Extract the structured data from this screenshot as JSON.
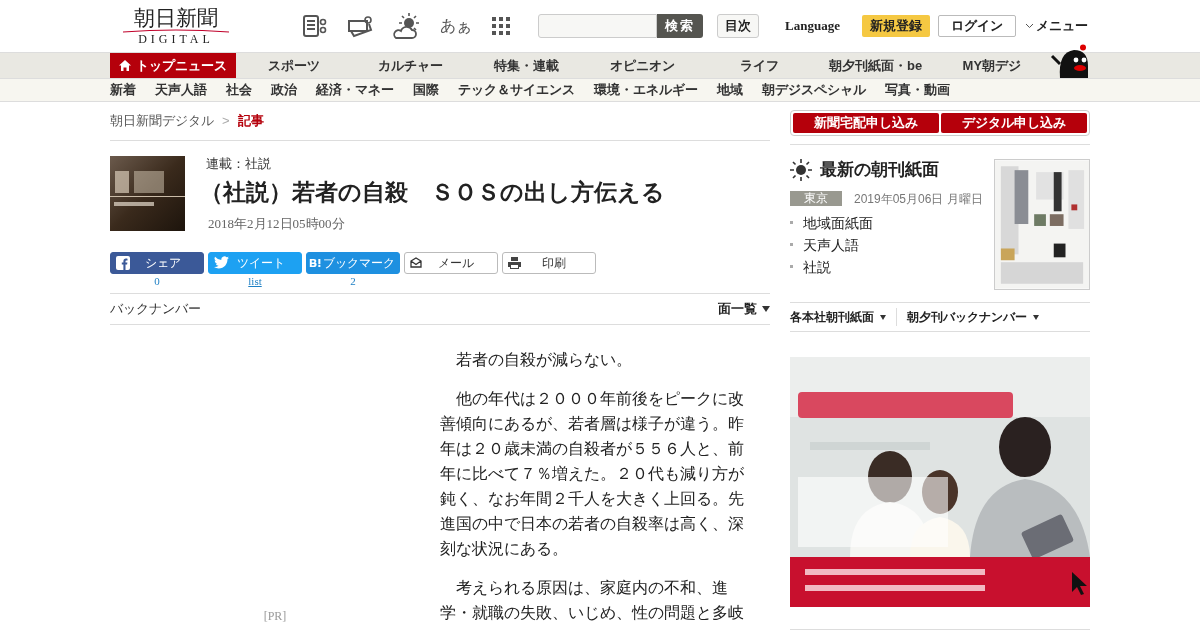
{
  "header": {
    "logo_top": "朝日新聞",
    "logo_bottom": "DIGITAL",
    "font_button": "あぁ",
    "search": {
      "button": "検索"
    },
    "index_button": "目次",
    "language": "Language",
    "register": "新規登録",
    "login": "ログイン",
    "menu": "メニュー"
  },
  "main_nav": [
    {
      "label": "トップニュース",
      "selected": true
    },
    {
      "label": "スポーツ",
      "selected": false
    },
    {
      "label": "カルチャー",
      "selected": false
    },
    {
      "label": "特集・連載",
      "selected": false
    },
    {
      "label": "オピニオン",
      "selected": false
    },
    {
      "label": "ライフ",
      "selected": false
    },
    {
      "label": "朝夕刊紙面・be",
      "selected": false
    },
    {
      "label": "MY朝デジ",
      "selected": false
    }
  ],
  "sub_nav": [
    "新着",
    "天声人語",
    "社会",
    "政治",
    "経済・マネー",
    "国際",
    "テック＆サイエンス",
    "環境・エネルギー",
    "地域",
    "朝デジスペシャル",
    "写真・動画"
  ],
  "breadcrumb_separator": ">",
  "breadcrumb": [
    {
      "label": "朝日新聞デジタル",
      "current": false
    },
    {
      "label": "記事",
      "current": true
    }
  ],
  "article": {
    "series": "連載：社説",
    "title": "（社説）若者の自殺　ＳＯＳの出し方伝える",
    "date": "2018年2月12日05時00分",
    "share": [
      {
        "kind": "facebook",
        "label": "シェア",
        "count": "0"
      },
      {
        "kind": "twitter",
        "label": "ツイート",
        "count": "list"
      },
      {
        "kind": "hatena",
        "label": "ブックマーク",
        "count": "2"
      },
      {
        "kind": "mail",
        "label": "メール"
      },
      {
        "kind": "print",
        "label": "印刷"
      }
    ],
    "backnumber": "バックナンバー",
    "page_list": "面一覧",
    "pr": "[PR]",
    "paragraphs": [
      "若者の自殺が減らない。",
      "他の年代は２０００年前後をピークに改善傾向にあるが、若者層は様子が違う。昨年は２０歳未満の自殺者が５５６人と、前年に比べて７％増えた。２０代も減り方が鈍く、なお年間２千人を大きく上回る。先進国の中で日本の若者の自殺率は高く、深刻な状況にある。",
      "考えられる原因は、家庭内の不和、進学・就職の失敗、いじめ、性の問題と多岐"
    ]
  },
  "sidebar": {
    "subscribe": [
      "新聞宅配申し込み",
      "デジタル申し込み"
    ],
    "paper_title": "最新の朝刊紙面",
    "region": "東京",
    "paper_date": "2019年05月06日 月曜日",
    "links": [
      "地域面紙面",
      "天声人語",
      "社説"
    ],
    "dropdowns": [
      "各本社朝刊紙面",
      "朝夕刊バックナンバー"
    ],
    "ad": {
      "kind": "picture"
    }
  }
}
